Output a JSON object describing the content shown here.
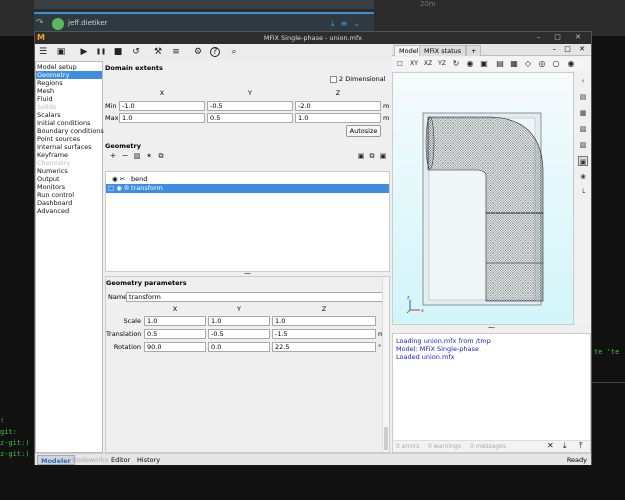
{
  "background": {
    "chat_user": "jeff.dietiker",
    "time_hint": "20m",
    "terminal_right": "te 'te",
    "terminal_left": [
      "!",
      "git:",
      "z-git:)",
      "z-git:)"
    ]
  },
  "window": {
    "logo": "M",
    "title": "MFiX Single-phase - union.mfx",
    "buttons": "– □ ✕"
  },
  "toolbar": [
    {
      "name": "menu-icon",
      "glyph": "☰"
    },
    {
      "name": "save-icon",
      "glyph": "▣"
    },
    {
      "name": "run-icon",
      "glyph": "▶"
    },
    {
      "name": "pause-icon",
      "glyph": "❚❚"
    },
    {
      "name": "stop-icon",
      "glyph": "■"
    },
    {
      "name": "reset-icon",
      "glyph": "↺"
    },
    {
      "name": "build-icon",
      "glyph": "⚒"
    },
    {
      "name": "parameters-icon",
      "glyph": "≡"
    },
    {
      "name": "settings-icon",
      "glyph": "⚙"
    },
    {
      "name": "help-icon",
      "glyph": "?"
    },
    {
      "name": "search-icon",
      "glyph": "⌕"
    }
  ],
  "nav": {
    "items": [
      {
        "label": "Model setup",
        "state": ""
      },
      {
        "label": "Geometry",
        "state": "sel"
      },
      {
        "label": "Regions",
        "state": ""
      },
      {
        "label": "Mesh",
        "state": ""
      },
      {
        "label": "Fluid",
        "state": ""
      },
      {
        "label": "Solids",
        "state": "dis"
      },
      {
        "label": "Scalars",
        "state": ""
      },
      {
        "label": "Initial conditions",
        "state": ""
      },
      {
        "label": "Boundary conditions",
        "state": ""
      },
      {
        "label": "Point sources",
        "state": ""
      },
      {
        "label": "Internal surfaces",
        "state": ""
      },
      {
        "label": "Keyframe",
        "state": ""
      },
      {
        "label": "Chemistry",
        "state": "dis"
      },
      {
        "label": "Numerics",
        "state": ""
      },
      {
        "label": "Output",
        "state": ""
      },
      {
        "label": "Monitors",
        "state": ""
      },
      {
        "label": "Run control",
        "state": ""
      },
      {
        "label": "Dashboard",
        "state": ""
      },
      {
        "label": "Advanced",
        "state": ""
      }
    ]
  },
  "domain": {
    "title": "Domain extents",
    "two_d_label": "2 Dimensional",
    "col_x": "X",
    "col_y": "Y",
    "col_z": "Z",
    "min_label": "Min",
    "max_label": "Max",
    "min": [
      "-1.0",
      "-0.5",
      "-2.0"
    ],
    "max": [
      "1.0",
      "0.5",
      "1.0"
    ],
    "unit": "m",
    "autosize": "Autosize"
  },
  "geometry": {
    "title": "Geometry",
    "tools": [
      "+",
      "−",
      "▧",
      "✶",
      "⧉"
    ],
    "ops": [
      "▣",
      "⧉",
      "▣"
    ],
    "rows": [
      {
        "name": "bend",
        "prefix": "◉ ✂"
      },
      {
        "name": "transform",
        "prefix": "□ ◉ ✇"
      }
    ]
  },
  "params": {
    "title": "Geometry parameters",
    "name_label": "Name",
    "name_value": "transform",
    "col_x": "X",
    "col_y": "Y",
    "col_z": "Z",
    "scale_label": "Scale",
    "scale": [
      "1.0",
      "1.0",
      "1.0"
    ],
    "translation_label": "Translation",
    "translation": [
      "0.5",
      "-0.5",
      "-1.5"
    ],
    "translation_unit": "m",
    "rotation_label": "Rotation",
    "rotation": [
      "90.0",
      "0.0",
      "22.5"
    ],
    "rotation_unit": "°"
  },
  "right": {
    "tab_model": "Model",
    "tab_status": "MFiX status",
    "tab_add": "+",
    "tab_btns": "– □ ✕",
    "viewbar": [
      "□",
      "XY",
      "XZ",
      "YZ",
      "↻",
      "◉",
      "▣",
      "▤",
      "▦",
      "◇",
      "◎",
      "○"
    ],
    "sidebar": [
      "‹",
      "▤",
      "▦",
      "▧",
      "▨",
      "▣",
      "❀",
      "└"
    ],
    "axes": {
      "z": "z",
      "x": "x"
    }
  },
  "console": {
    "lines": [
      "Loading union.mfx from /tmp",
      "Model: MFiX Single-phase",
      "Loaded union.mfx"
    ],
    "errors": "0 errors",
    "warnings": "0 warnings",
    "messages": "0 messages",
    "icons": [
      "✕",
      "⤓",
      "⤒"
    ]
  },
  "status": {
    "modes": [
      "Modeler",
      "Nodeworks",
      "Editor",
      "History"
    ],
    "text": "Ready"
  }
}
